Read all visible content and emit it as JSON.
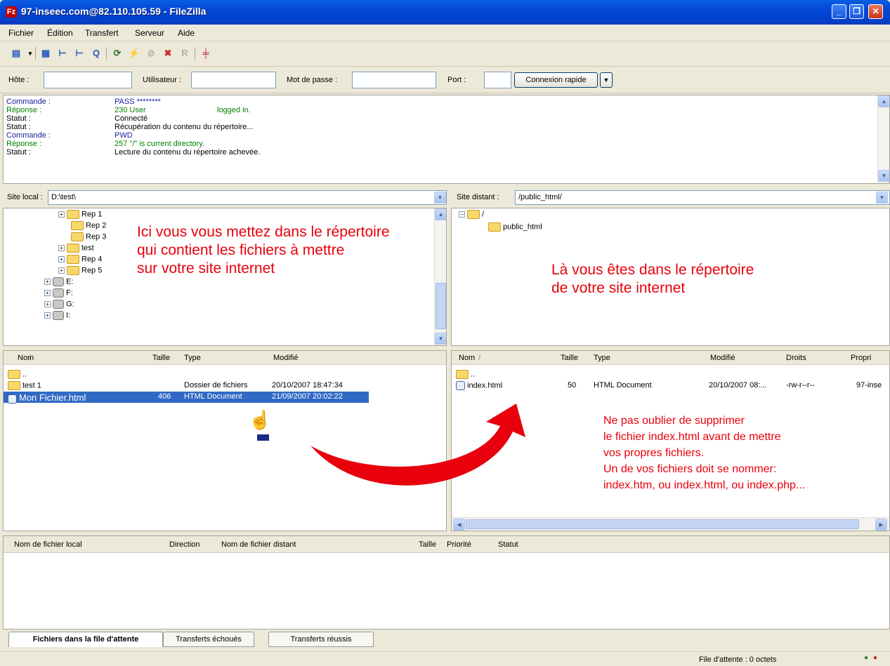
{
  "window": {
    "title": "97-inseec.com@82.110.105.59 - FileZilla",
    "app_icon": "Fz"
  },
  "menu": [
    "Fichier",
    "Édition",
    "Transfert",
    "Serveur",
    "Aide"
  ],
  "quickconnect": {
    "host_label": "Hôte :",
    "user_label": "Utilisateur :",
    "password_label": "Mot de passe :",
    "port_label": "Port :",
    "button": "Connexion rapide",
    "host_value": "",
    "user_value": "",
    "password_value": "",
    "port_value": ""
  },
  "log": [
    {
      "label": "Commande :",
      "msg": "PASS ********",
      "color": "#1a1aa0"
    },
    {
      "label": "Réponse :",
      "msg": "230 User",
      "msg2": "logged in.",
      "color": "#008000"
    },
    {
      "label": "Statut :",
      "msg": "Connecté",
      "color": "#000000"
    },
    {
      "label": "Statut :",
      "msg": "Récupération du contenu du répertoire...",
      "color": "#000000"
    },
    {
      "label": "Commande :",
      "msg": "PWD",
      "color": "#1a1aa0"
    },
    {
      "label": "Réponse :",
      "msg": "257 \"/\" is current directory.",
      "color": "#008000"
    },
    {
      "label": "Statut :",
      "msg": "Lecture du contenu du répertoire achevée.",
      "color": "#000000"
    }
  ],
  "local": {
    "label": "Site local :",
    "path": "D:\\test\\",
    "tree": [
      "Rep 1",
      "Rep 2",
      "Rep 3",
      "test",
      "Rep 4",
      "Rep 5",
      "E:",
      "F:",
      "G:",
      "I:"
    ],
    "columns": [
      "Nom",
      "Taille",
      "Type",
      "Modifié"
    ],
    "files": [
      {
        "name": "..",
        "size": "",
        "type": "",
        "modified": ""
      },
      {
        "name": "test 1",
        "size": "",
        "type": "Dossier de fichiers",
        "modified": "20/10/2007 18:47:34"
      },
      {
        "name": "Mon Fichier.html",
        "size": "406",
        "type": "HTML Document",
        "modified": "21/09/2007 20:02:22"
      }
    ]
  },
  "remote": {
    "label": "Site distant :",
    "path": "/public_html/",
    "tree": [
      "/",
      "public_html"
    ],
    "columns": [
      "Nom",
      "Taille",
      "Type",
      "Modifié",
      "Droits",
      "Propri"
    ],
    "files": [
      {
        "name": "..",
        "size": "",
        "type": "",
        "modified": "",
        "rights": "",
        "owner": ""
      },
      {
        "name": "index.html",
        "size": "50",
        "type": "HTML Document",
        "modified": "20/10/2007 08:...",
        "rights": "-rw-r--r--",
        "owner": "97-inse"
      }
    ]
  },
  "annotations": {
    "local": "Ici vous vous mettez dans le répertoire\nqui contient les fichiers à mettre\nsur votre site internet",
    "remote": "Là vous êtes dans le répertoire\nde votre site internet",
    "note": "Ne pas oublier de supprimer\nle fichier index.html avant de mettre\nvos propres fichiers.\nUn de vos fichiers doit se nommer:\nindex.htm, ou index.html, ou index.php..."
  },
  "queue": {
    "columns": [
      "Nom de fichier local",
      "Direction",
      "Nom de fichier distant",
      "Taille",
      "Priorité",
      "Statut"
    ]
  },
  "tabs": [
    "Fichiers dans la file d'attente",
    "Transferts échoués",
    "Transferts réussis"
  ],
  "status": {
    "queue": "File d'attente : 0 octets"
  },
  "colors": {
    "annotation": "#e8000c",
    "selection": "#316ac5",
    "titlebar": "#0346d6"
  }
}
